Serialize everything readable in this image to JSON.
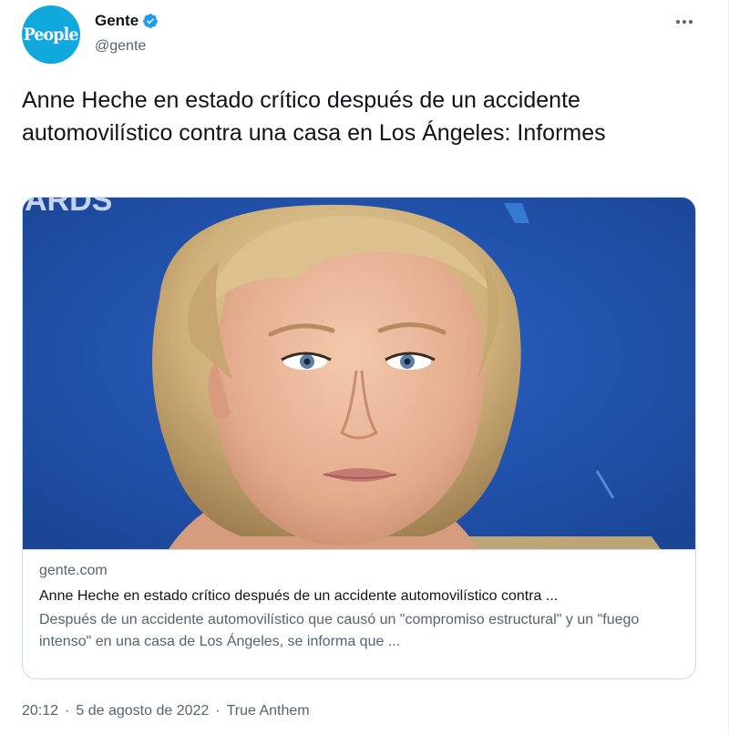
{
  "author": {
    "avatar_text": "People",
    "display_name": "Gente",
    "handle": "@gente",
    "verified": true
  },
  "tweet": {
    "text": "Anne Heche en estado crítico después de un accidente automovilístico contra una casa en Los Ángeles: Informes"
  },
  "card": {
    "image_alt": "Anne Heche portrait in front of a blue backdrop",
    "backdrop_text": "ARDS",
    "domain": "gente.com",
    "title": "Anne Heche en estado crítico después de un accidente automovilístico contra ...",
    "description": "Después de un accidente automovilístico que causó un \"compromiso estructural\" y un \"fuego intenso\" en una casa de Los Ángeles, se informa que ..."
  },
  "meta": {
    "time": "20:12",
    "date": "5 de agosto de 2022",
    "source": "True Anthem",
    "separator": "·"
  },
  "colors": {
    "verified_blue": "#1d9bf0",
    "secondary_text": "#536471",
    "backdrop_blue": "#1f56b5",
    "avatar_bg": "#11a8de"
  },
  "icons": {
    "verified": "verified-badge-icon",
    "more": "more-horizontal-icon"
  }
}
